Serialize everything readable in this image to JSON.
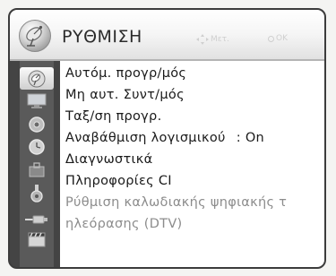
{
  "header": {
    "title": "ΡΥΘΜΙΣΗ",
    "title_icon": "satellite-dish-icon",
    "move_hint": "Μετ.",
    "ok_hint": "OK"
  },
  "categories": [
    {
      "icon": "satellite-dish-icon",
      "active": true
    },
    {
      "icon": "monitor-icon"
    },
    {
      "icon": "sort-dial-icon"
    },
    {
      "icon": "clock-icon"
    },
    {
      "icon": "lock-box-icon"
    },
    {
      "icon": "ci-card-icon"
    },
    {
      "icon": "cable-plug-icon"
    },
    {
      "icon": "dtv-clapboard-icon"
    }
  ],
  "menu_items": [
    {
      "label": "Αυτόμ. προγρ/μός"
    },
    {
      "label": "Μη αυτ. Συντ/μός"
    },
    {
      "label": "Ταξ/ση προγρ."
    },
    {
      "label": "Αναβάθμιση λογισμικού",
      "value": ": On"
    },
    {
      "label": "Διαγνωστικά"
    },
    {
      "label": "Πληροφορίες CI"
    },
    {
      "label": "Ρύθμιση καλωδιακής ψηφιακής τ",
      "disabled": true
    },
    {
      "label": "ηλεόρασης (DTV)",
      "disabled": true
    }
  ],
  "colors": {
    "panel": "#444444",
    "icon_column": "#5a5a5a",
    "content_bg": "#ffffff",
    "text": "#1a1a1a",
    "disabled_text": "#8c8c8c"
  }
}
